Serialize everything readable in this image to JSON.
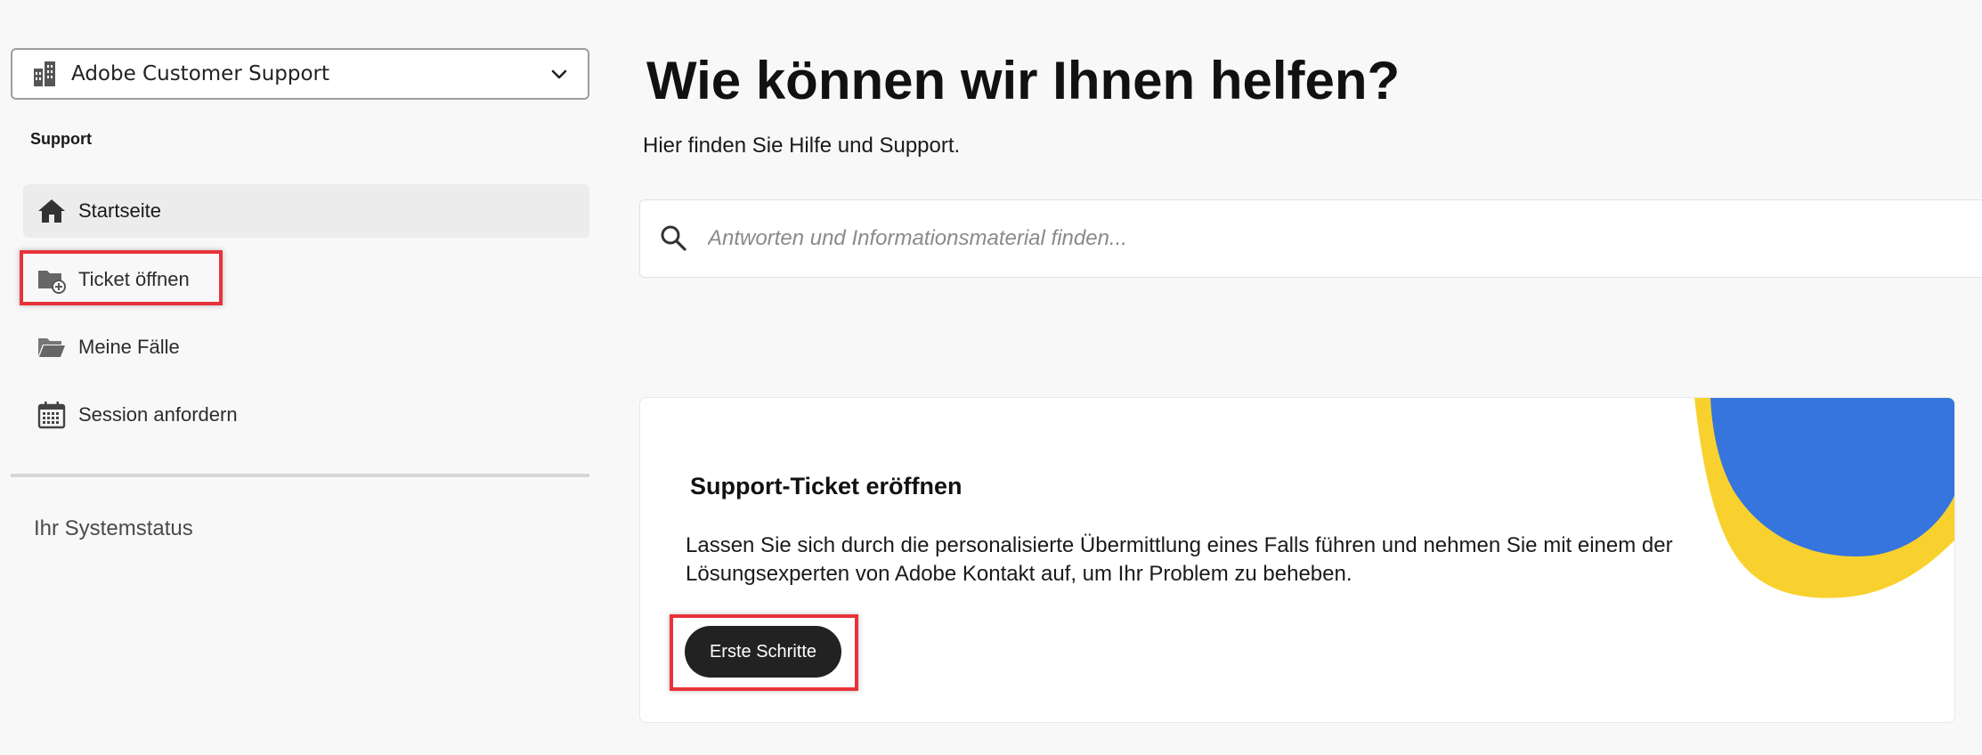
{
  "org_selector": {
    "name": "Adobe Customer Support",
    "icon": "building-icon"
  },
  "sidebar": {
    "section_title": "Support",
    "items": [
      {
        "label": "Startseite",
        "icon": "home-icon",
        "active": true
      },
      {
        "label": "Ticket öffnen",
        "icon": "folder-add-icon",
        "active": false
      },
      {
        "label": "Meine Fälle",
        "icon": "folder-open-icon",
        "active": false
      },
      {
        "label": "Session anfordern",
        "icon": "calendar-icon",
        "active": false
      }
    ],
    "system_status": "Ihr Systemstatus"
  },
  "main": {
    "title": "Wie können wir Ihnen helfen?",
    "subtitle": "Hier finden Sie Hilfe und Support.",
    "search": {
      "placeholder": "Antworten und Informationsmaterial finden...",
      "value": ""
    },
    "card": {
      "title": "Support-Ticket eröffnen",
      "description": "Lassen Sie sich durch die personalisierte Übermittlung eines Falls führen und nehmen Sie mit einem der Lösungsexperten von Adobe Kontakt auf, um Ihr Problem zu beheben.",
      "button_label": "Erste Schritte"
    }
  },
  "colors": {
    "highlight": "#e8323a",
    "decor_blue": "#3575dd",
    "decor_yellow": "#f9d12e",
    "button_bg": "#222222"
  }
}
